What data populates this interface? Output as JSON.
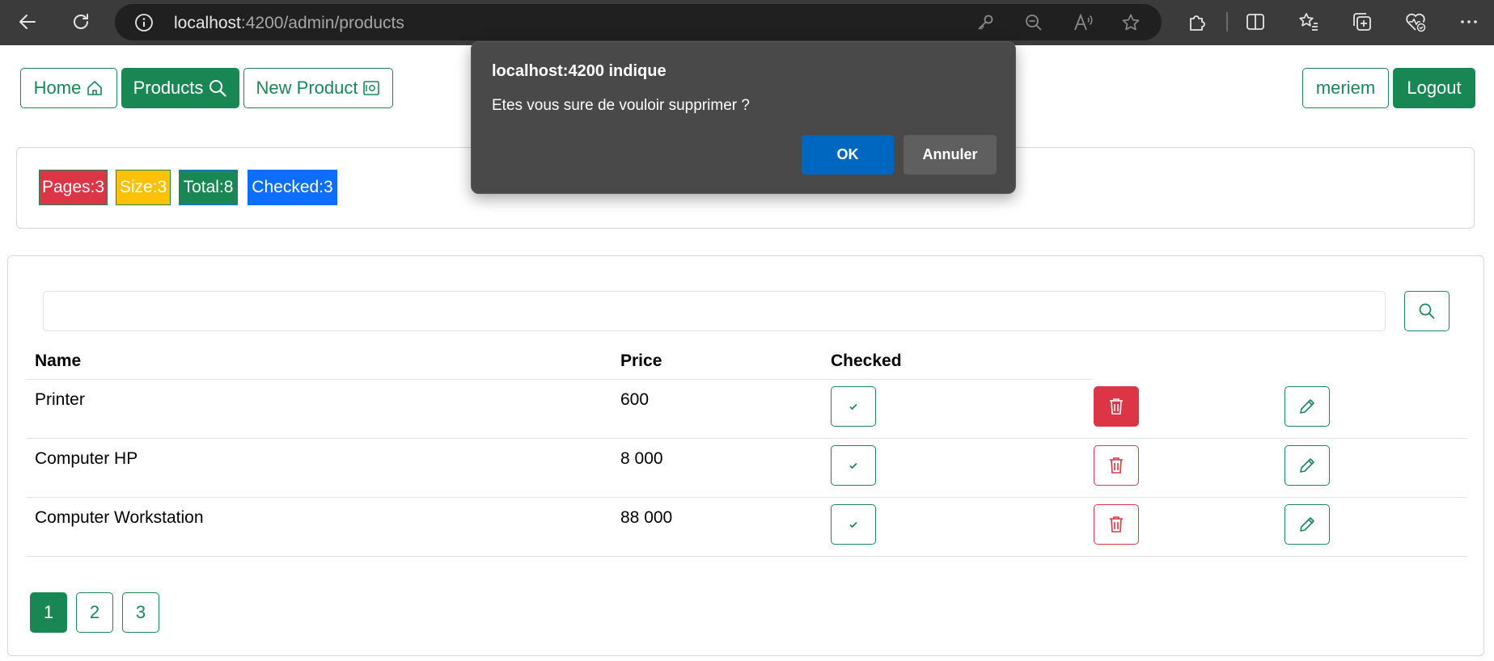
{
  "browser": {
    "url_host": "localhost",
    "url_rest": ":4200/admin/products"
  },
  "nav": {
    "home_label": "Home",
    "products_label": "Products",
    "new_product_label": "New Product",
    "user_label": "meriem",
    "logout_label": "Logout"
  },
  "stats": {
    "pages": "Pages:3",
    "size": "Size:3",
    "total": "Total:8",
    "checked": "Checked:3"
  },
  "search": {
    "value": "",
    "placeholder": ""
  },
  "table": {
    "headers": {
      "name": "Name",
      "price": "Price",
      "checked": "Checked"
    },
    "rows": [
      {
        "name": "Printer",
        "price": "600",
        "checked": true
      },
      {
        "name": "Computer HP",
        "price": "8 000",
        "checked": true
      },
      {
        "name": "Computer Workstation",
        "price": "88 000",
        "checked": true
      }
    ]
  },
  "pagination": {
    "pages": [
      "1",
      "2",
      "3"
    ],
    "current": "1"
  },
  "dialog": {
    "title": "localhost:4200 indique",
    "message": "Etes vous sure de vouloir supprimer ?",
    "ok_label": "OK",
    "cancel_label": "Annuler"
  },
  "colors": {
    "primary_green": "#198754",
    "danger_red": "#dc3545",
    "warning_yellow": "#ffc107",
    "info_blue": "#0d6efd",
    "dialog_bg": "#494949",
    "dialog_ok": "#0067c0"
  }
}
